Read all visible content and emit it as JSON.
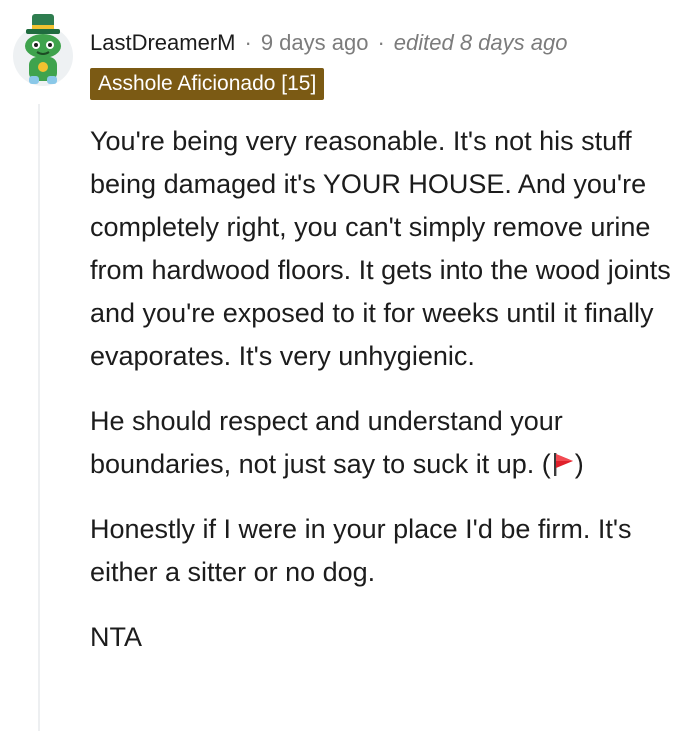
{
  "comment": {
    "username": "LastDreamerM",
    "separator": "·",
    "time_ago": "9 days ago",
    "edited": "edited 8 days ago",
    "flair": "Asshole Aficionado [15]",
    "colors": {
      "flair_bg": "#7b5a14",
      "flair_text": "#ffffff",
      "meta_text": "#7c7c7c",
      "body_text": "#1c1c1c",
      "flag": "#e0202b"
    },
    "paragraphs": {
      "p1": "You're being very reasonable. It's not his stuff being damaged it's YOUR HOUSE. And you're completely right, you can't simply remove urine from hardwood floors. It gets into the wood joints and you're exposed to it for weeks until it finally evaporates. It's very unhygienic.",
      "p2_text": "He should respect and understand your boundaries, not just say to suck it up. (",
      "p2_close": ")",
      "p3": "Honestly if I were in your place I'd be firm. It's either a sitter or no dog.",
      "p4": "NTA"
    },
    "icons": {
      "avatar": "snoo-avatar-icon",
      "flag": "red-flag-icon"
    }
  }
}
